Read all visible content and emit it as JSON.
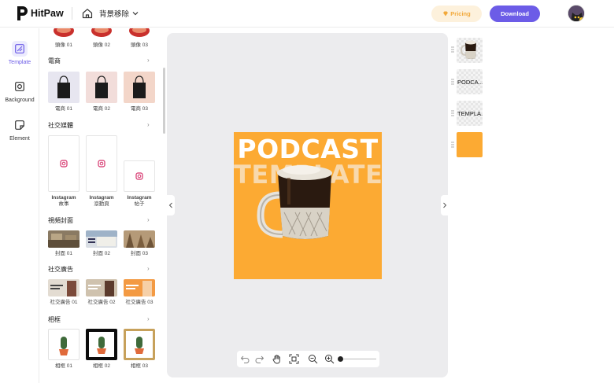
{
  "header": {
    "logo_text": "HitPaw",
    "breadcrumb": "背景移除",
    "pricing_label": "Pricing",
    "download_label": "Download"
  },
  "rail": {
    "items": [
      {
        "label": "Template",
        "icon": "template-icon",
        "active": true
      },
      {
        "label": "Background",
        "icon": "background-icon",
        "active": false
      },
      {
        "label": "Element",
        "icon": "element-icon",
        "active": false
      }
    ]
  },
  "panel": {
    "top_row_captions": [
      "頭像 01",
      "頭像 02",
      "頭像 03"
    ],
    "sections": [
      {
        "title": "電商",
        "captions": [
          "電商 01",
          "電商 02",
          "電商 03"
        ]
      },
      {
        "title": "社交媒體",
        "captions": [
          [
            "Instagram",
            "故事"
          ],
          [
            "Instagram",
            "滾動頁"
          ],
          [
            "Instagram",
            "帖子"
          ]
        ]
      },
      {
        "title": "視頻封面",
        "captions": [
          "封面 01",
          "封面 02",
          "封面 03"
        ]
      },
      {
        "title": "社交廣告",
        "captions": [
          "社交廣告 01",
          "社交廣告 02",
          "社交廣告 03"
        ]
      },
      {
        "title": "相框",
        "captions": [
          "相框 01",
          "相框 02",
          "相框 03"
        ]
      }
    ]
  },
  "canvas": {
    "title_line1": "PODCAST",
    "title_line2": "TEMPLATE",
    "background_color": "#fcaa33"
  },
  "layers": [
    {
      "type": "image",
      "label": ""
    },
    {
      "type": "text",
      "label": "PODCA..."
    },
    {
      "type": "text",
      "label": "TEMPLA..."
    },
    {
      "type": "color",
      "label": "",
      "color": "#fcaa33"
    }
  ],
  "colors": {
    "accent": "#6c5ce7",
    "pricing_bg": "#fdf1dc",
    "pricing_text": "#f2a93b"
  }
}
